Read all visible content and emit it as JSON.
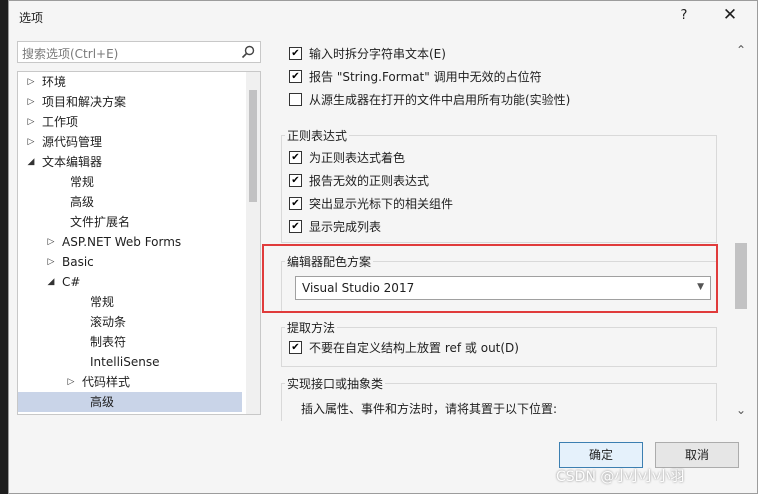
{
  "window": {
    "title": "选项",
    "help_label": "?",
    "close_label": "✕"
  },
  "search": {
    "placeholder": "搜索选项(Ctrl+E)",
    "icon": "search-icon"
  },
  "tree": {
    "items": [
      {
        "label": "环境",
        "arrow": "right",
        "level": 0
      },
      {
        "label": "项目和解决方案",
        "arrow": "right",
        "level": 0
      },
      {
        "label": "工作项",
        "arrow": "right",
        "level": 0
      },
      {
        "label": "源代码管理",
        "arrow": "right",
        "level": 0
      },
      {
        "label": "文本编辑器",
        "arrow": "down",
        "level": 0
      },
      {
        "label": "常规",
        "arrow": "none",
        "level": 1
      },
      {
        "label": "高级",
        "arrow": "none",
        "level": 1
      },
      {
        "label": "文件扩展名",
        "arrow": "none",
        "level": 1
      },
      {
        "label": "ASP.NET Web Forms",
        "arrow": "right",
        "level": 1
      },
      {
        "label": "Basic",
        "arrow": "right",
        "level": 1
      },
      {
        "label": "C#",
        "arrow": "down",
        "level": 1
      },
      {
        "label": "常规",
        "arrow": "none",
        "level": 2
      },
      {
        "label": "滚动条",
        "arrow": "none",
        "level": 2
      },
      {
        "label": "制表符",
        "arrow": "none",
        "level": 2
      },
      {
        "label": "IntelliSense",
        "arrow": "none",
        "level": 2
      },
      {
        "label": "代码样式",
        "arrow": "right",
        "level": 2
      },
      {
        "label": "高级",
        "arrow": "none",
        "level": 2,
        "selected": true
      }
    ]
  },
  "options": {
    "top_checks": [
      {
        "label": "输入时拆分字符串文本(E)",
        "checked": true
      },
      {
        "label": "报告 \"String.Format\" 调用中无效的占位符",
        "checked": true
      },
      {
        "label": "从源生成器在打开的文件中启用所有功能(实验性)",
        "checked": false
      }
    ],
    "regex": {
      "title": "正则表达式",
      "checks": [
        {
          "label": "为正则表达式着色",
          "checked": true
        },
        {
          "label": "报告无效的正则表达式",
          "checked": true
        },
        {
          "label": "突出显示光标下的相关组件",
          "checked": true
        },
        {
          "label": "显示完成列表",
          "checked": true
        }
      ]
    },
    "color_scheme": {
      "title": "编辑器配色方案",
      "value": "Visual Studio 2017"
    },
    "extract": {
      "title": "提取方法",
      "check_label": "不要在自定义结构上放置 ref 或 out(D)",
      "checked": true
    },
    "implement": {
      "title": "实现接口或抽象类",
      "text": "插入属性、事件和方法时，请将其置于以下位置:"
    }
  },
  "buttons": {
    "ok": "确定",
    "cancel": "取消"
  },
  "watermark": "CSDN @小小小小羽",
  "colors": {
    "highlight": "#e03b3b",
    "selected": "#c9d4e8",
    "primary_border": "#3c7fb1"
  }
}
